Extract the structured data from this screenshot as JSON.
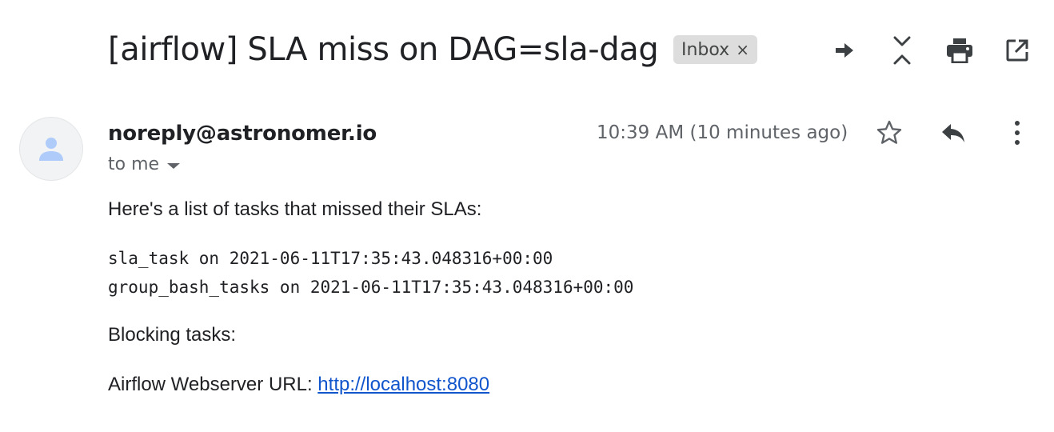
{
  "email": {
    "subject": "[airflow] SLA miss on DAG=sla-dag",
    "label": {
      "name": "Inbox",
      "remove_glyph": "×"
    },
    "toolbar": {
      "icons": [
        "forward-arrow-icon",
        "collapse-all-icon",
        "print-icon",
        "open-in-new-window-icon"
      ]
    },
    "sender": {
      "address": "noreply@astronomer.io",
      "recipient_summary": "to me",
      "timestamp": "10:39 AM (10 minutes ago)",
      "avatar_icon": "person-icon"
    },
    "message_actions": {
      "icons": [
        "star-icon",
        "reply-icon",
        "more-vert-icon"
      ]
    },
    "body": {
      "intro": "Here's a list of tasks that missed their SLAs:",
      "missed_tasks": [
        "sla_task on 2021-06-11T17:35:43.048316+00:00",
        "group_bash_tasks on 2021-06-11T17:35:43.048316+00:00"
      ],
      "blocking_label": "Blocking tasks:",
      "webserver_label": "Airflow Webserver URL: ",
      "webserver_url": "http://localhost:8080"
    }
  },
  "colors": {
    "text": "#202124",
    "secondary": "#5f6368",
    "link": "#1155cc",
    "chip_bg": "#dddddd"
  }
}
